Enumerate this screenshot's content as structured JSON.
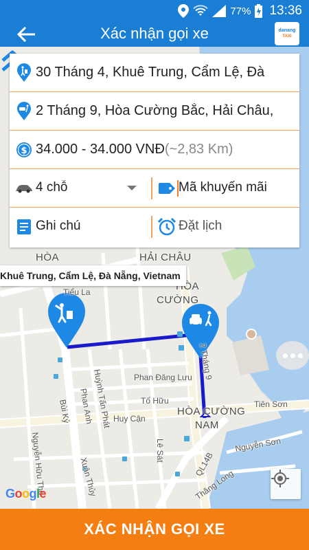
{
  "status_bar": {
    "battery_percent": "77%",
    "time": "13:36"
  },
  "app_bar": {
    "title": "Xác nhận gọi xe",
    "logo_text_top": "danang",
    "logo_text_bottom": "TAXI"
  },
  "form": {
    "pickup": "30 Tháng 4, Khuê Trung, Cẩm Lệ, Đà",
    "dropoff": "2 Tháng 9, Hòa Cường Bắc, Hải Châu,",
    "price": "34.000 - 34.000 VNĐ",
    "distance": "(~2,83 Km)",
    "vehicle_type": "4 chỗ",
    "promo_placeholder": "Mã khuyến mãi",
    "note_placeholder": "Ghi chú",
    "schedule_label": "Đặt lịch"
  },
  "map": {
    "tooltip": "Khuê Trung, Cẩm Lệ, Đà Nẵng, Vietnam",
    "labels": {
      "hoa": "HÒA",
      "hai_chau": "HẢI CHÂU",
      "hoa_cuong": "HÒA",
      "hoa_cuong2": "CƯỜNG",
      "hoa_cuong_nam": "HÒA CƯỜNG",
      "nam": "NAM",
      "tieu_la": "Tiểu La",
      "phan_dang_luu": "Phan Đăng Lưu",
      "to_huu": "Tố Hữu",
      "huy_can": "Huy Cận",
      "tien_son": "Tiên Sơn",
      "nguyen_son": "Nguyễn Sơn",
      "le_sat": "Lê Sát",
      "thang_long": "Thăng Long",
      "ql14b": "QL14B",
      "huynh_tan_phat": "Huỳnh Tấn Phát",
      "phan_anh": "Phan Anh",
      "bui_ky": "Bùi Kỷ",
      "xuan_thuy": "Xuân Thủy",
      "nguyen_huu_tho": "Nguyễn Hữu Thọ",
      "thang_9": "2 Tháng 9"
    },
    "google": [
      "G",
      "o",
      "o",
      "g",
      "l",
      "e"
    ],
    "colors": {
      "route": "#1a1acc",
      "pin": "#1e88e5",
      "water": "#a9cdee",
      "road": "#ffffff"
    }
  },
  "confirm_button": "XÁC NHẬN GỌI XE"
}
